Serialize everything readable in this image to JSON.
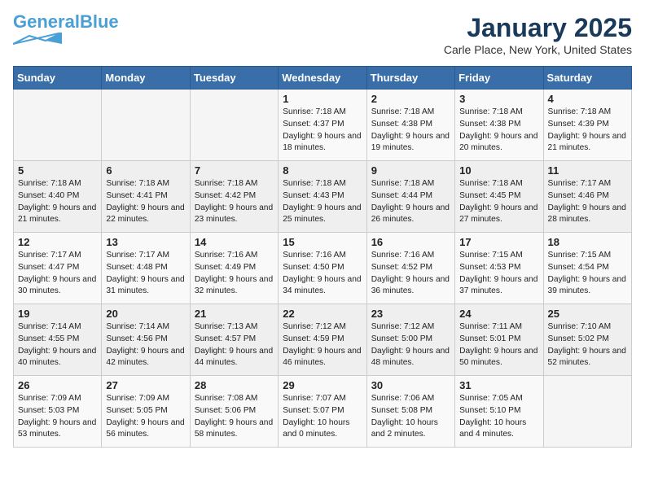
{
  "logo": {
    "part1": "General",
    "part2": "Blue"
  },
  "title": "January 2025",
  "location": "Carle Place, New York, United States",
  "weekdays": [
    "Sunday",
    "Monday",
    "Tuesday",
    "Wednesday",
    "Thursday",
    "Friday",
    "Saturday"
  ],
  "weeks": [
    [
      {
        "day": "",
        "info": ""
      },
      {
        "day": "",
        "info": ""
      },
      {
        "day": "",
        "info": ""
      },
      {
        "day": "1",
        "info": "Sunrise: 7:18 AM\nSunset: 4:37 PM\nDaylight: 9 hours\nand 18 minutes."
      },
      {
        "day": "2",
        "info": "Sunrise: 7:18 AM\nSunset: 4:38 PM\nDaylight: 9 hours\nand 19 minutes."
      },
      {
        "day": "3",
        "info": "Sunrise: 7:18 AM\nSunset: 4:38 PM\nDaylight: 9 hours\nand 20 minutes."
      },
      {
        "day": "4",
        "info": "Sunrise: 7:18 AM\nSunset: 4:39 PM\nDaylight: 9 hours\nand 21 minutes."
      }
    ],
    [
      {
        "day": "5",
        "info": "Sunrise: 7:18 AM\nSunset: 4:40 PM\nDaylight: 9 hours\nand 21 minutes."
      },
      {
        "day": "6",
        "info": "Sunrise: 7:18 AM\nSunset: 4:41 PM\nDaylight: 9 hours\nand 22 minutes."
      },
      {
        "day": "7",
        "info": "Sunrise: 7:18 AM\nSunset: 4:42 PM\nDaylight: 9 hours\nand 23 minutes."
      },
      {
        "day": "8",
        "info": "Sunrise: 7:18 AM\nSunset: 4:43 PM\nDaylight: 9 hours\nand 25 minutes."
      },
      {
        "day": "9",
        "info": "Sunrise: 7:18 AM\nSunset: 4:44 PM\nDaylight: 9 hours\nand 26 minutes."
      },
      {
        "day": "10",
        "info": "Sunrise: 7:18 AM\nSunset: 4:45 PM\nDaylight: 9 hours\nand 27 minutes."
      },
      {
        "day": "11",
        "info": "Sunrise: 7:17 AM\nSunset: 4:46 PM\nDaylight: 9 hours\nand 28 minutes."
      }
    ],
    [
      {
        "day": "12",
        "info": "Sunrise: 7:17 AM\nSunset: 4:47 PM\nDaylight: 9 hours\nand 30 minutes."
      },
      {
        "day": "13",
        "info": "Sunrise: 7:17 AM\nSunset: 4:48 PM\nDaylight: 9 hours\nand 31 minutes."
      },
      {
        "day": "14",
        "info": "Sunrise: 7:16 AM\nSunset: 4:49 PM\nDaylight: 9 hours\nand 32 minutes."
      },
      {
        "day": "15",
        "info": "Sunrise: 7:16 AM\nSunset: 4:50 PM\nDaylight: 9 hours\nand 34 minutes."
      },
      {
        "day": "16",
        "info": "Sunrise: 7:16 AM\nSunset: 4:52 PM\nDaylight: 9 hours\nand 36 minutes."
      },
      {
        "day": "17",
        "info": "Sunrise: 7:15 AM\nSunset: 4:53 PM\nDaylight: 9 hours\nand 37 minutes."
      },
      {
        "day": "18",
        "info": "Sunrise: 7:15 AM\nSunset: 4:54 PM\nDaylight: 9 hours\nand 39 minutes."
      }
    ],
    [
      {
        "day": "19",
        "info": "Sunrise: 7:14 AM\nSunset: 4:55 PM\nDaylight: 9 hours\nand 40 minutes."
      },
      {
        "day": "20",
        "info": "Sunrise: 7:14 AM\nSunset: 4:56 PM\nDaylight: 9 hours\nand 42 minutes."
      },
      {
        "day": "21",
        "info": "Sunrise: 7:13 AM\nSunset: 4:57 PM\nDaylight: 9 hours\nand 44 minutes."
      },
      {
        "day": "22",
        "info": "Sunrise: 7:12 AM\nSunset: 4:59 PM\nDaylight: 9 hours\nand 46 minutes."
      },
      {
        "day": "23",
        "info": "Sunrise: 7:12 AM\nSunset: 5:00 PM\nDaylight: 9 hours\nand 48 minutes."
      },
      {
        "day": "24",
        "info": "Sunrise: 7:11 AM\nSunset: 5:01 PM\nDaylight: 9 hours\nand 50 minutes."
      },
      {
        "day": "25",
        "info": "Sunrise: 7:10 AM\nSunset: 5:02 PM\nDaylight: 9 hours\nand 52 minutes."
      }
    ],
    [
      {
        "day": "26",
        "info": "Sunrise: 7:09 AM\nSunset: 5:03 PM\nDaylight: 9 hours\nand 53 minutes."
      },
      {
        "day": "27",
        "info": "Sunrise: 7:09 AM\nSunset: 5:05 PM\nDaylight: 9 hours\nand 56 minutes."
      },
      {
        "day": "28",
        "info": "Sunrise: 7:08 AM\nSunset: 5:06 PM\nDaylight: 9 hours\nand 58 minutes."
      },
      {
        "day": "29",
        "info": "Sunrise: 7:07 AM\nSunset: 5:07 PM\nDaylight: 10 hours\nand 0 minutes."
      },
      {
        "day": "30",
        "info": "Sunrise: 7:06 AM\nSunset: 5:08 PM\nDaylight: 10 hours\nand 2 minutes."
      },
      {
        "day": "31",
        "info": "Sunrise: 7:05 AM\nSunset: 5:10 PM\nDaylight: 10 hours\nand 4 minutes."
      },
      {
        "day": "",
        "info": ""
      }
    ]
  ]
}
